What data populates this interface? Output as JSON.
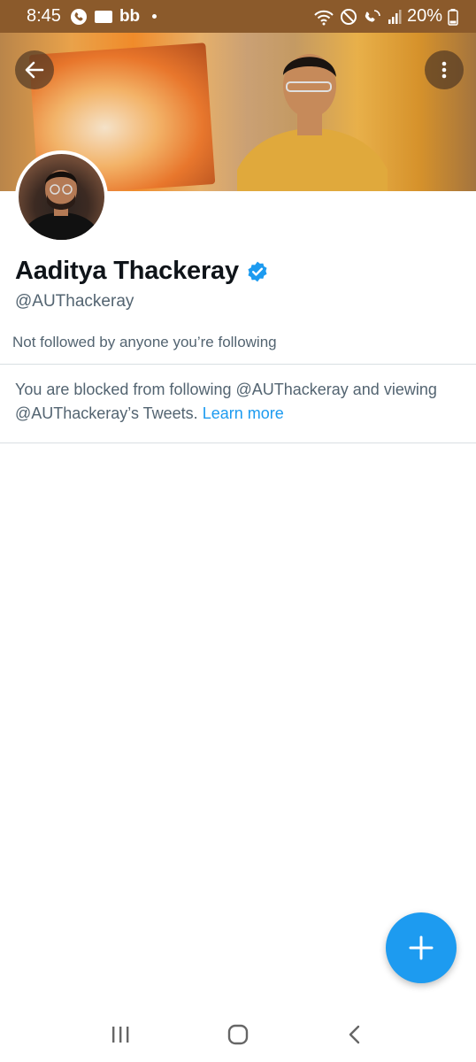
{
  "status_bar": {
    "time": "8:45",
    "battery": "20%",
    "left_icons": [
      "phone-call-icon",
      "notification-badge-icon",
      "bb-app-icon",
      "dot-icon"
    ],
    "right_icons": [
      "wifi-icon",
      "do-not-disturb-icon",
      "wifi-calling-icon",
      "signal-icon",
      "battery-icon"
    ],
    "bb_label": "bb"
  },
  "header": {
    "back_icon": "arrow-left-icon",
    "more_icon": "more-vertical-icon"
  },
  "profile": {
    "name": "Aaditya Thackeray",
    "verified_icon": "verified-badge-icon",
    "handle": "@AUThackeray",
    "followers_note": "Not followed by anyone you’re following"
  },
  "blocked": {
    "message": "You are blocked from following @AUThackeray and viewing @AUThackeray’s Tweets. ",
    "link": "Learn more"
  },
  "fab": {
    "icon": "plus-icon"
  },
  "nav": {
    "recent_icon": "recent-apps-icon",
    "home_icon": "home-icon",
    "back_icon": "back-chevron-icon"
  },
  "colors": {
    "status_bar_bg": "#8b5a2b",
    "accent": "#1d9bf0",
    "secondary_text": "#536471"
  }
}
